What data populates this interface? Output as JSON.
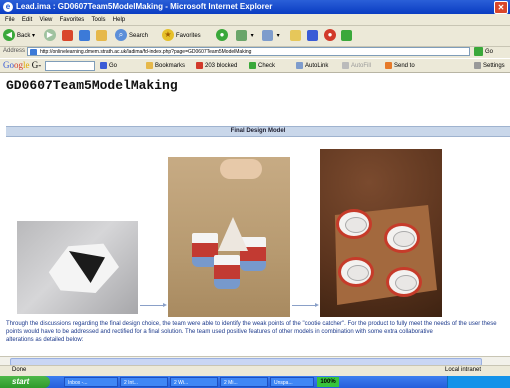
{
  "window": {
    "title": "Lead.ima : GD0607Team5ModelMaking - Microsoft Internet Explorer",
    "close_glyph": "✕"
  },
  "menu": [
    "File",
    "Edit",
    "View",
    "Favorites",
    "Tools",
    "Help"
  ],
  "toolbar": {
    "back": "Back",
    "search": "Search",
    "favorites": "Favorites"
  },
  "address": {
    "label": "Address",
    "url": "http://onlinelearning.dmem.strath.ac.uk/ladima/fd-index.php?page=GD0607Team5ModelMaking",
    "go": "Go"
  },
  "googlebar": {
    "logo": [
      "Go",
      "og",
      "le"
    ],
    "logo_suffix": " G-",
    "items": [
      "Go",
      "Bookmarks",
      "203 blocked",
      "Check",
      "AutoLink",
      "AutoFill",
      "Send to",
      "Settings"
    ]
  },
  "page": {
    "title": "GD0607Team5ModelMaking",
    "section_title": "Final Design Model",
    "description_line1": "Through the discussions regarding the final design choice, the team were able to identify the weak points of the \"cootie catcher\". For the product to fully meet the needs of the user these",
    "description_line2": "points would have to be addressed and rectified for a final solution. The team used positive features of other models in combination with some extra collaborative",
    "description_line3": "alterations as detailed below:"
  },
  "status": {
    "left": "Done",
    "right": "Local intranet"
  },
  "taskbar": {
    "start": "start",
    "tasks": [
      "Inbox -...",
      "2 Int...",
      "2 Wi...",
      "2 Mi...",
      "Unspa..."
    ],
    "percent": "100%"
  },
  "colors": {
    "titlebar": "#0a3cc2",
    "section": "#c9d7ea",
    "desc_text": "#1d3a8c",
    "taskbar": "#245edb"
  }
}
